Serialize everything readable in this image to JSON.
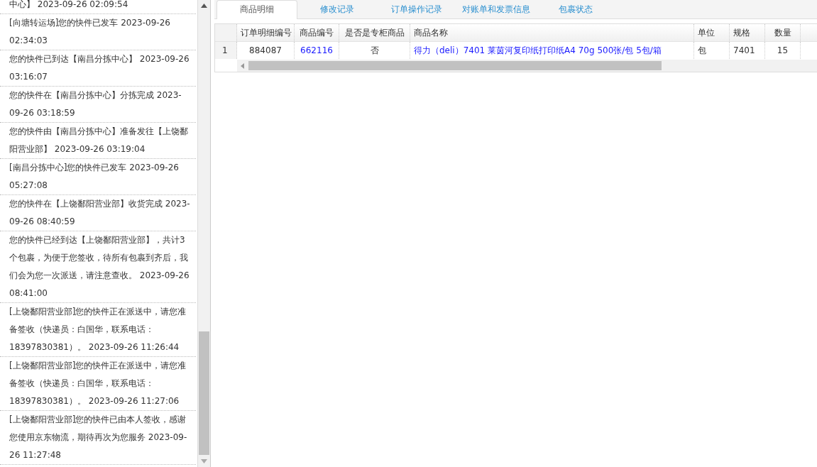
{
  "tracking": {
    "entries": [
      "中心】 2023-09-26 02:09:54",
      "[向塘转运场]您的快件已发车 2023-09-26 02:34:03",
      "您的快件已到达【南昌分拣中心】 2023-09-26 03:16:07",
      "您的快件在【南昌分拣中心】分拣完成 2023-09-26 03:18:59",
      "您的快件由【南昌分拣中心】准备发往【上饶鄱阳营业部】 2023-09-26 03:19:04",
      "[南昌分拣中心]您的快件已发车 2023-09-26 05:27:08",
      "您的快件在【上饶鄱阳营业部】收货完成 2023-09-26 08:40:59",
      "您的快件已经到达【上饶鄱阳营业部】，共计3个包裹，为便于您签收，待所有包裹到齐后，我们会为您一次派送，请注意查收。 2023-09-26 08:41:00",
      "[上饶鄱阳营业部]您的快件正在派送中，请您准备签收（快递员：白国华，联系电话：18397830381）。 2023-09-26 11:26:44",
      "[上饶鄱阳营业部]您的快件正在派送中，请您准备签收（快递员：白国华，联系电话：18397830381）。 2023-09-26 11:27:06",
      "[上饶鄱阳营业部]您的快件已由本人签收，感谢您使用京东物流，期待再次为您服务 2023-09-26 11:27:48"
    ]
  },
  "tabs": [
    {
      "label": "商品明细",
      "selected": true
    },
    {
      "label": "修改记录",
      "selected": false
    },
    {
      "label": "订单操作记录",
      "selected": false
    },
    {
      "label": "对账单和发票信息",
      "selected": false
    },
    {
      "label": "包裹状态",
      "selected": false
    }
  ],
  "table": {
    "columns": [
      {
        "label": "订单明细编号",
        "kind": "text"
      },
      {
        "label": "商品编号",
        "kind": "link"
      },
      {
        "label": "是否是专柜商品",
        "kind": "text"
      },
      {
        "label": "商品名称",
        "kind": "link"
      },
      {
        "label": "单位",
        "kind": "text"
      },
      {
        "label": "规格",
        "kind": "text"
      },
      {
        "label": "数量",
        "kind": "text"
      }
    ],
    "rows": [
      {
        "index": "1",
        "cells": [
          "884087",
          "662116",
          "否",
          "得力（deli）7401 莱茵河复印纸打印纸A4 70g 500张/包 5包/箱",
          "包",
          "7401",
          "15"
        ]
      }
    ]
  }
}
